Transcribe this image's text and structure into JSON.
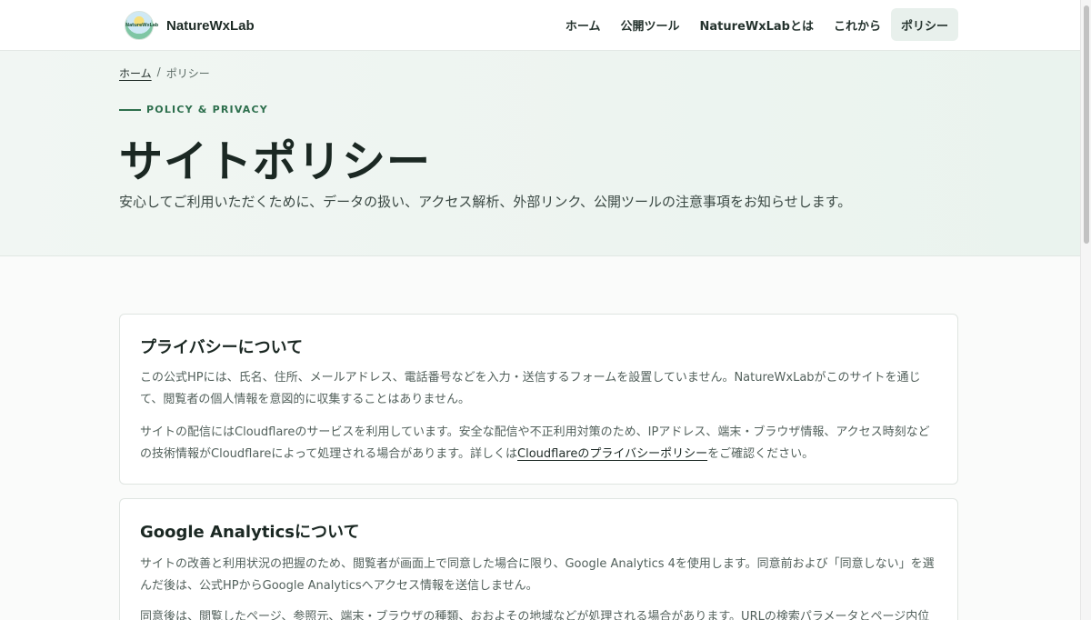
{
  "header": {
    "brand": "NatureWxLab",
    "logo_text": "NatureWxLab",
    "nav": [
      {
        "label": "ホーム"
      },
      {
        "label": "公開ツール"
      },
      {
        "label": "NatureWxLabとは"
      },
      {
        "label": "これから"
      },
      {
        "label": "ポリシー",
        "active": true
      }
    ]
  },
  "breadcrumb": {
    "home": "ホーム",
    "separator": "/",
    "current": "ポリシー"
  },
  "hero": {
    "eyebrow": "POLICY & PRIVACY",
    "title": "サイトポリシー",
    "lead": "安心してご利用いただくために、データの扱い、アクセス解析、外部リンク、公開ツールの注意事項をお知らせします。"
  },
  "sections": {
    "privacy": {
      "title": "プライバシーについて",
      "p1": "この公式HPには、氏名、住所、メールアドレス、電話番号などを入力・送信するフォームを設置していません。NatureWxLabがこのサイトを通じて、閲覧者の個人情報を意図的に収集することはありません。",
      "p2_before": "サイトの配信にはCloudflareのサービスを利用しています。安全な配信や不正利用対策のため、IPアドレス、端末・ブラウザ情報、アクセス時刻などの技術情報がCloudflareによって処理される場合があります。詳しくは",
      "p2_link": "Cloudflareのプライバシーポリシー",
      "p2_after": "をご確認ください。"
    },
    "analytics": {
      "title": "Google Analyticsについて",
      "p1": "サイトの改善と利用状況の把握のため、閲覧者が画面上で同意した場合に限り、Google Analytics 4を使用します。同意前および「同意しない」を選んだ後は、公式HPからGoogle Analyticsへアクセス情報を送信しません。",
      "p2": "同意後は、閲覧したページ、参照元、端末・ブラウザの種類、おおよその地域などが処理される場合があります。URLの検索パラメータとページ内位"
    }
  },
  "colors": {
    "accent": "#2d6f4d",
    "nav_active_bg": "#e8f0ec"
  }
}
